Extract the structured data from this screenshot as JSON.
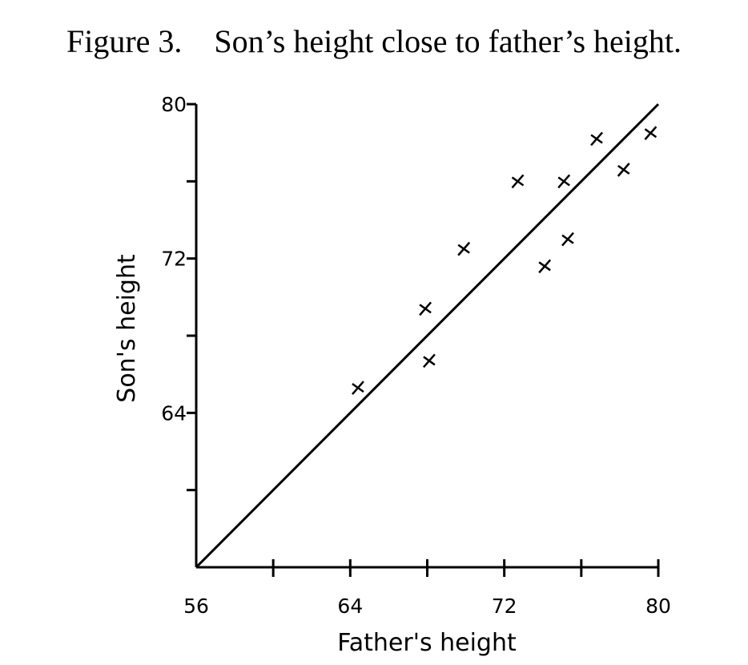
{
  "chart_data": {
    "type": "scatter",
    "title": "Figure 3.    Son’s height close to father’s height.",
    "xlabel": "Father's height",
    "ylabel": "Son's height",
    "xlim": [
      56,
      80
    ],
    "ylim": [
      56,
      80
    ],
    "x_ticks": [
      56,
      60,
      64,
      68,
      72,
      76,
      80
    ],
    "x_tick_labels": [
      "56",
      "",
      "64",
      "",
      "72",
      "",
      "80"
    ],
    "y_ticks": [
      60,
      64,
      68,
      72,
      76,
      80
    ],
    "y_tick_labels": [
      "",
      "64",
      "",
      "72",
      "",
      "80"
    ],
    "grid": false,
    "marker": "x",
    "reference_line": {
      "from": [
        56,
        56
      ],
      "to": [
        80,
        80
      ]
    },
    "points": [
      {
        "x": 64.4,
        "y": 65.3
      },
      {
        "x": 67.9,
        "y": 69.4
      },
      {
        "x": 68.1,
        "y": 66.7
      },
      {
        "x": 69.9,
        "y": 72.5
      },
      {
        "x": 72.7,
        "y": 76.0
      },
      {
        "x": 74.1,
        "y": 71.6
      },
      {
        "x": 75.1,
        "y": 76.0
      },
      {
        "x": 75.3,
        "y": 73.0
      },
      {
        "x": 76.8,
        "y": 78.2
      },
      {
        "x": 78.2,
        "y": 76.6
      },
      {
        "x": 79.6,
        "y": 78.5
      }
    ]
  }
}
